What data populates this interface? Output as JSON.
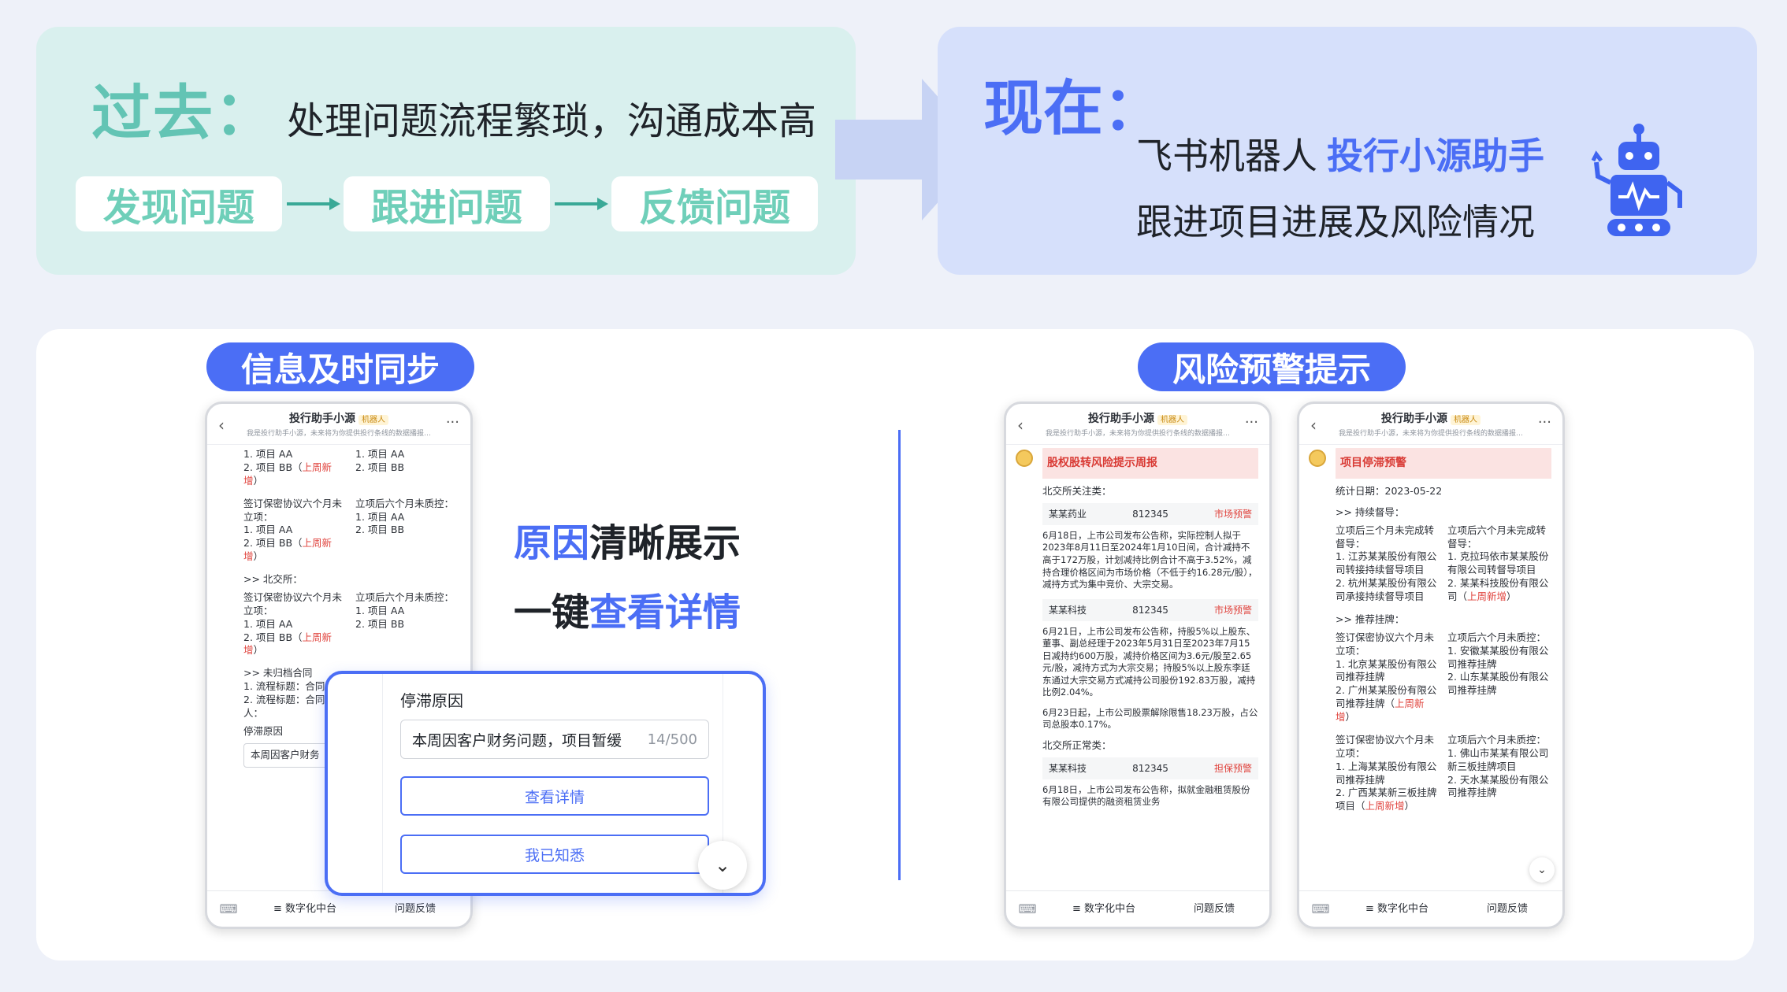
{
  "past": {
    "label": "过去",
    "colon": "：",
    "desc": "处理问题流程繁琐，沟通成本高",
    "steps": [
      "发现问题",
      "跟进问题",
      "反馈问题"
    ]
  },
  "now": {
    "label": "现在：",
    "line1_prefix": "飞书机器人",
    "line1_highlight": "投行小源助手",
    "line2": "跟进项目进展及风险情况"
  },
  "left_section": {
    "badge": "信息及时同步",
    "tagline1_blue": "原因",
    "tagline1_rest": "清晰展示",
    "tagline2_black": "一键",
    "tagline2_blue": "查看详情"
  },
  "right_section": {
    "badge": "风险预警提示"
  },
  "phone_common": {
    "title": "投行助手小源",
    "bot_tag": "机器人",
    "subtitle": "我是投行助手小源，未来将为你提供投行条线的数据播报…",
    "back": "‹",
    "more": "···",
    "footer_left": "≡ 数字化中台",
    "footer_right": "问题反馈"
  },
  "phone1": {
    "block1_left": [
      "1. 项目 AA",
      "2. 项目 BB（",
      "上周新增",
      "）"
    ],
    "block1_right": [
      "1. 项目 AA",
      "2. 项目 BB"
    ],
    "block2_left_title": "签订保密协议六个月未立项：",
    "block2_right_title": "立项后六个月未质控：",
    "item_aa": "1. 项目 AA",
    "item_bb": "2. 项目 BB",
    "item_bb_new_prefix": "2. 项目 BB（",
    "new_tag": "上周新增",
    "new_suffix": "）",
    "bse": ">> 北交所：",
    "unfiled": ">> 未归档合同",
    "flow1": "1. 流程标题：合同",
    "flow2": "2. 流程标题：合同",
    "flow2_tail": "人：",
    "stall_label": "停滞原因",
    "stall_value": "本周因客户财务"
  },
  "popup": {
    "label": "停滞原因",
    "input_value": "本周因客户财务问题，项目暂缓",
    "counter": "14/500",
    "btn_detail": "查看详情",
    "btn_ack": "我已知悉",
    "expand": "⌄"
  },
  "phone2": {
    "card_title": "股权股转风险提示周报",
    "sec1": "北交所关注类：",
    "rows": [
      {
        "name": "某某药业",
        "code": "812345",
        "tag": "市场预警"
      },
      {
        "name": "某某科技",
        "code": "812345",
        "tag": "市场预警"
      },
      {
        "name": "某某科技",
        "code": "812345",
        "tag": "担保预警"
      }
    ],
    "para1": "6月18日，上市公司发布公告称，实际控制人拟于2023年8月11日至2024年1月10日间，合计减持不高于172万股，计划减持比例合计不高于3.52%，减持合理价格区间为市场价格（不低于约16.28元/股），减持方式为集中竞价、大宗交易。",
    "para2": "6月21日，上市公司发布公告称，持股5%以上股东、董事、副总经理于2023年5月31日至2023年7月15日减持约600万股，减持价格区间为3.6元/股至2.65元/股，减持方式为大宗交易；持股5%以上股东李廷东通过大宗交易方式减持公司股份192.83万股，减持比例2.04%。",
    "para3": "6月23日起，上市公司股票解除限售18.23万股，占公司总股本0.17%。",
    "sec2": "北交所正常类：",
    "para4": "6月18日，上市公司发布公告称，拟就金融租赁股份有限公司提供的融资租赁业务"
  },
  "phone3": {
    "card_title": "项目停滞预警",
    "stat_date": "统计日期：2023-05-22",
    "sec_supervise": ">> 持续督导：",
    "a_left_title": "立项后三个月未完成转督导：",
    "a_left": [
      "1. 江苏某某股份有限公司转接持续督导项目",
      "2. 杭州某某股份有限公司承接持续督导项目"
    ],
    "a_right_title": "立项后六个月未完成转督导：",
    "a_right_1": "1. 克拉玛依市某某股份有限公司转督导项目",
    "a_right_2_prefix": "2. 某某科技股份有限公司（",
    "a_right_2_new": "上周新增",
    "a_right_2_suffix": "）",
    "sec_listing": ">> 推荐挂牌：",
    "b_left_title": "签订保密协议六个月未立项：",
    "b_left_1": "1. 北京某某股份有限公司推荐挂牌",
    "b_left_2_prefix": "2. 广州某某股份有限公司推荐挂牌（",
    "b_left_2_new": "上周新增",
    "b_left_2_suffix": "）",
    "b_right_title": "立项后六个月未质控：",
    "b_right": [
      "1. 安徽某某股份有限公司推荐挂牌",
      "2. 山东某某股份有限公司推荐挂牌"
    ],
    "c_left_title": "签订保密协议六个月未立项：",
    "c_left_1": "1. 上海某某股份有限公司推荐挂牌",
    "c_left_2_prefix": "2. 广西某某新三板挂牌项目（",
    "c_left_2_new": "上周新增",
    "c_left_2_suffix": "）",
    "c_right_title": "立项后六个月未质控：",
    "c_right": [
      "1. 佛山市某某有限公司新三板挂牌项目",
      "2. 天水某某股份有限公司推荐挂牌"
    ]
  },
  "colors": {
    "accent": "#4b6ef5",
    "teal": "#63c4b4",
    "warn": "#e0443e"
  }
}
